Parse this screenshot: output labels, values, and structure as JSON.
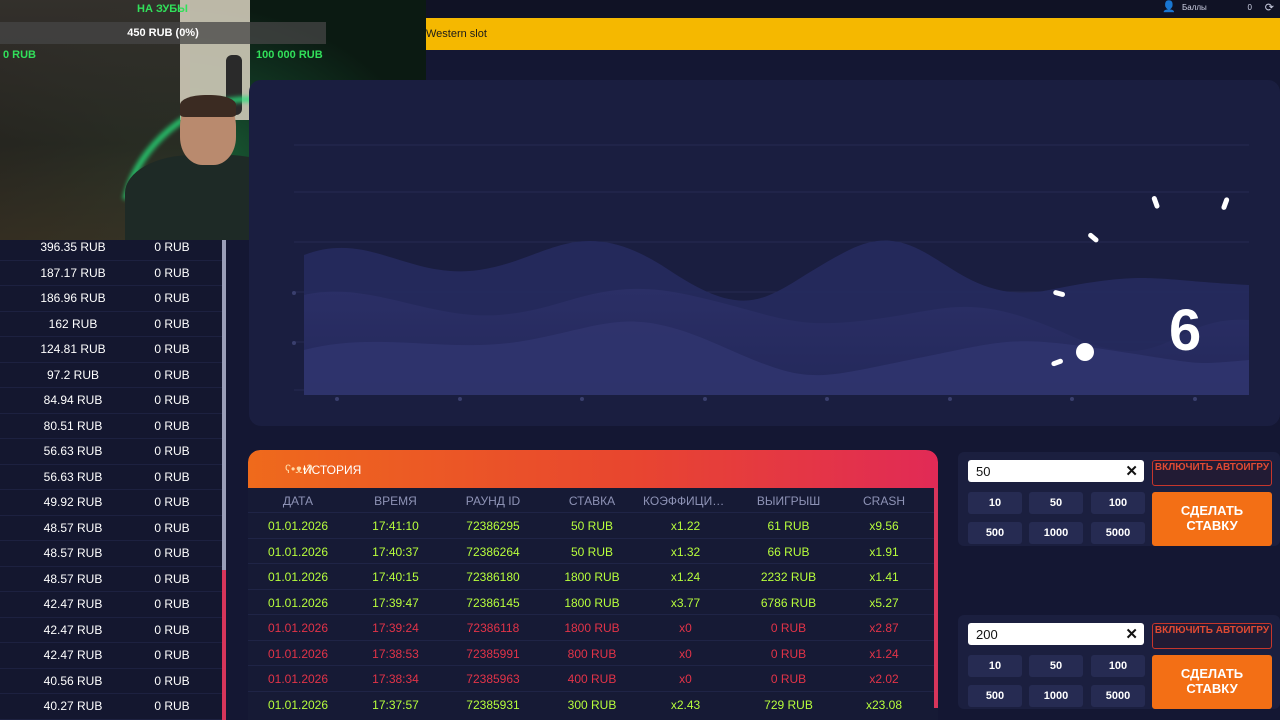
{
  "topbar": {
    "points_label": "Баллы",
    "points_value": "0",
    "tab": "Western slot"
  },
  "stream_overlay": {
    "title": "НА ЗУБЫ",
    "progress_text": "450 RUB (0%)",
    "progress_fraction": 0,
    "min": "0 RUB",
    "max": "100 000 RUB"
  },
  "left_list": {
    "rows": [
      {
        "amount": "396.35 RUB",
        "win": "0 RUB"
      },
      {
        "amount": "187.17 RUB",
        "win": "0 RUB"
      },
      {
        "amount": "186.96 RUB",
        "win": "0 RUB"
      },
      {
        "amount": "162 RUB",
        "win": "0 RUB"
      },
      {
        "amount": "124.81 RUB",
        "win": "0 RUB"
      },
      {
        "amount": "97.2 RUB",
        "win": "0 RUB"
      },
      {
        "amount": "84.94 RUB",
        "win": "0 RUB"
      },
      {
        "amount": "80.51 RUB",
        "win": "0 RUB"
      },
      {
        "amount": "56.63 RUB",
        "win": "0 RUB"
      },
      {
        "amount": "56.63 RUB",
        "win": "0 RUB"
      },
      {
        "amount": "49.92 RUB",
        "win": "0 RUB"
      },
      {
        "amount": "48.57 RUB",
        "win": "0 RUB"
      },
      {
        "amount": "48.57 RUB",
        "win": "0 RUB"
      },
      {
        "amount": "48.57 RUB",
        "win": "0 RUB"
      },
      {
        "amount": "42.47 RUB",
        "win": "0 RUB"
      },
      {
        "amount": "42.47 RUB",
        "win": "0 RUB"
      },
      {
        "amount": "42.47 RUB",
        "win": "0 RUB"
      },
      {
        "amount": "40.56 RUB",
        "win": "0 RUB"
      },
      {
        "amount": "40.27 RUB",
        "win": "0 RUB"
      }
    ]
  },
  "game": {
    "countdown": "6"
  },
  "history": {
    "title": "ИСТОРИЯ",
    "columns": [
      "ДАТА",
      "ВРЕМЯ",
      "РАУНД ID",
      "СТАВКА",
      "КОЭФФИЦИЕНТ",
      "ВЫИГРЫШ",
      "CRASH"
    ],
    "rows": [
      {
        "status": "win",
        "cells": [
          "01.01.2026",
          "17:41:10",
          "72386295",
          "50 RUB",
          "x1.22",
          "61 RUB",
          "x9.56"
        ]
      },
      {
        "status": "win",
        "cells": [
          "01.01.2026",
          "17:40:37",
          "72386264",
          "50 RUB",
          "x1.32",
          "66 RUB",
          "x1.91"
        ]
      },
      {
        "status": "win",
        "cells": [
          "01.01.2026",
          "17:40:15",
          "72386180",
          "1800 RUB",
          "x1.24",
          "2232 RUB",
          "x1.41"
        ]
      },
      {
        "status": "win",
        "cells": [
          "01.01.2026",
          "17:39:47",
          "72386145",
          "1800 RUB",
          "x3.77",
          "6786 RUB",
          "x5.27"
        ]
      },
      {
        "status": "loss",
        "cells": [
          "01.01.2026",
          "17:39:24",
          "72386118",
          "1800 RUB",
          "x0",
          "0 RUB",
          "x2.87"
        ]
      },
      {
        "status": "loss",
        "cells": [
          "01.01.2026",
          "17:38:53",
          "72385991",
          "800 RUB",
          "x0",
          "0 RUB",
          "x1.24"
        ]
      },
      {
        "status": "loss",
        "cells": [
          "01.01.2026",
          "17:38:34",
          "72385963",
          "400 RUB",
          "x0",
          "0 RUB",
          "x2.02"
        ]
      },
      {
        "status": "win",
        "cells": [
          "01.01.2026",
          "17:37:57",
          "72385931",
          "300 RUB",
          "x2.43",
          "729 RUB",
          "x23.08"
        ]
      }
    ]
  },
  "bets": [
    {
      "value": "50",
      "auto_label": "ВКЛЮЧИТЬ АВТОИГРУ",
      "chips": [
        "10",
        "50",
        "100",
        "500",
        "1000",
        "5000"
      ],
      "bet_label": "СДЕЛАТЬ СТАВКУ"
    },
    {
      "value": "200",
      "auto_label": "ВКЛЮЧИТЬ АВТОИГРУ",
      "chips": [
        "10",
        "50",
        "100",
        "500",
        "1000",
        "5000"
      ],
      "bet_label": "СДЕЛАТЬ СТАВКУ"
    }
  ],
  "colors": {
    "win": "#b8ff3c",
    "loss": "#e23348",
    "accent": "#f36f15",
    "banner": "#f5b800",
    "overlay_text": "#31e05a"
  },
  "icons": {
    "user": "user-icon",
    "refresh": "refresh-icon",
    "history": "bear-icon",
    "clear": "close-icon"
  }
}
